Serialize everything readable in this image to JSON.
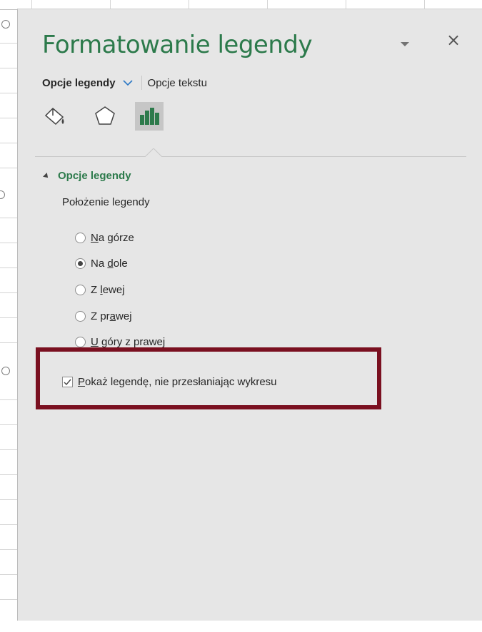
{
  "pane": {
    "title": "Formatowanie legendy",
    "dropdown_icon": "triangle-down-icon",
    "close_label": "×"
  },
  "tabs": {
    "primary": "Opcje legendy",
    "secondary": "Opcje tekstu"
  },
  "icons": [
    {
      "name": "fill-line-icon",
      "active": false
    },
    {
      "name": "effects-pentagon-icon",
      "active": false
    },
    {
      "name": "legend-options-chart-icon",
      "active": true
    }
  ],
  "section": {
    "title": "Opcje legendy",
    "position_label": "Położenie legendy",
    "options": [
      {
        "pre": "",
        "ul": "N",
        "post": "a górze",
        "checked": false
      },
      {
        "pre": "Na ",
        "ul": "d",
        "post": "ole",
        "checked": true
      },
      {
        "pre": "Z ",
        "ul": "l",
        "post": "ewej",
        "checked": false
      },
      {
        "pre": "Z pr",
        "ul": "a",
        "post": "wej",
        "checked": false
      },
      {
        "pre": "",
        "ul": "U",
        "post": " góry z prawej",
        "checked": false
      }
    ],
    "checkbox": {
      "ul": "P",
      "post": "okaż legendę, nie przesłaniając wykresu",
      "checked": true
    }
  },
  "colors": {
    "accent": "#2c7a4b",
    "highlight": "#7a1020",
    "pane_bg": "#e6e6e6"
  }
}
